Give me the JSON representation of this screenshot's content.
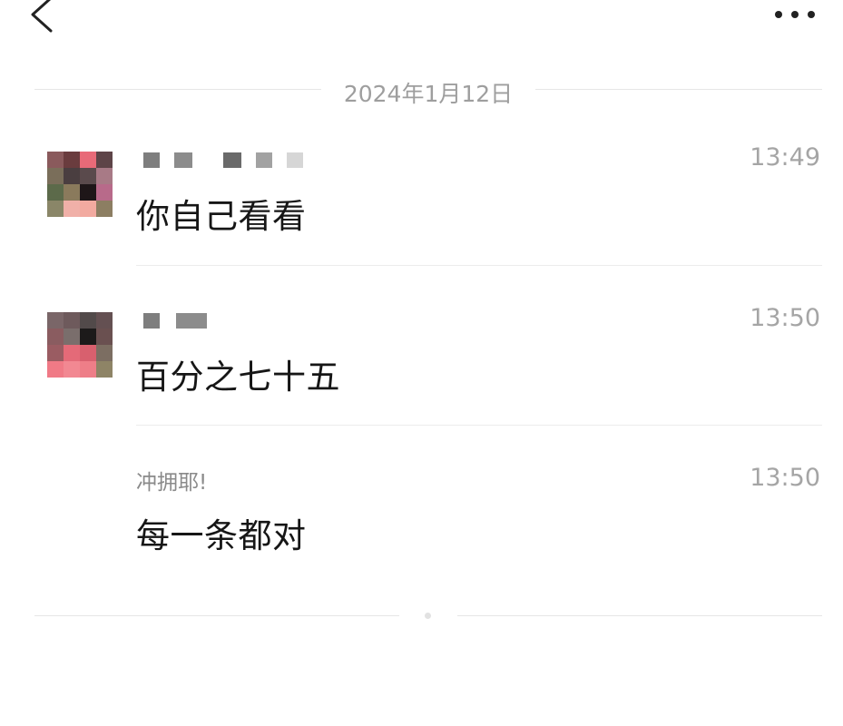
{
  "header": {
    "back_icon": "chevron-left-icon",
    "more_icon": "more-dots-icon"
  },
  "date_divider": "2024年1月12日",
  "messages": [
    {
      "sender": "",
      "time": "13:49",
      "text": "你自己看看",
      "avatar_blurred": true,
      "sender_blurred": true
    },
    {
      "sender": "",
      "time": "13:50",
      "text": "百分之七十五",
      "avatar_blurred": true,
      "sender_blurred": true
    },
    {
      "sender": "冲拥耶!",
      "time": "13:50",
      "text": "每一条都对",
      "avatar_blurred": false,
      "sender_blurred": false
    }
  ],
  "colors": {
    "background": "#ffffff",
    "muted_text": "#9e9e9e",
    "divider": "#e6e6e6",
    "message_text": "#161616"
  }
}
